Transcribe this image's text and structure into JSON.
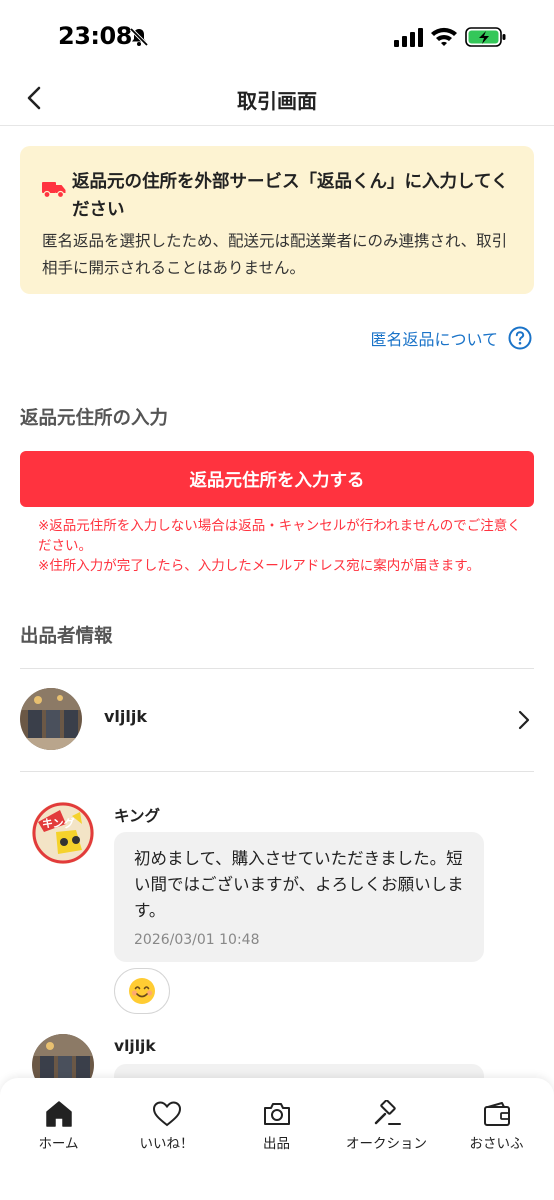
{
  "status_bar": {
    "time": "23:08"
  },
  "header": {
    "title": "取引画面"
  },
  "notice": {
    "title": "返品元の住所を外部サービス「返品くん」に入力してください",
    "body": "匿名返品を選択したため、配送元は配送業者にのみ連携され、取引相手に開示されることはありません。"
  },
  "help_link": {
    "label": "匿名返品について"
  },
  "address_section": {
    "heading": "返品元住所の入力",
    "button_label": "返品元住所を入力する",
    "warning_1": "※返品元住所を入力しない場合は返品・キャンセルが行われませんのでご注意ください。",
    "warning_2": "※住所入力が完了したら、入力したメールアドレス宛に案内が届きます。"
  },
  "seller_section": {
    "heading": "出品者情報",
    "seller_name": "vljljk"
  },
  "messages": [
    {
      "sender": "キング",
      "text": "初めまして、購入させていただきました。短い間ではございますが、よろしくお願いします。",
      "timestamp": "2026/03/01 10:48",
      "reaction": "😊"
    },
    {
      "sender": "vljljk"
    }
  ],
  "tabs": [
    {
      "label": "ホーム",
      "icon": "home-icon"
    },
    {
      "label": "いいね！",
      "icon": "heart-icon"
    },
    {
      "label": "出品",
      "icon": "camera-icon"
    },
    {
      "label": "オークション",
      "icon": "gavel-icon"
    },
    {
      "label": "おさいふ",
      "icon": "wallet-icon"
    }
  ],
  "colors": {
    "accent_red": "#ff333f",
    "link_blue": "#1a73c8",
    "notice_bg": "#fdf3d2",
    "battery_green": "#34c759"
  }
}
